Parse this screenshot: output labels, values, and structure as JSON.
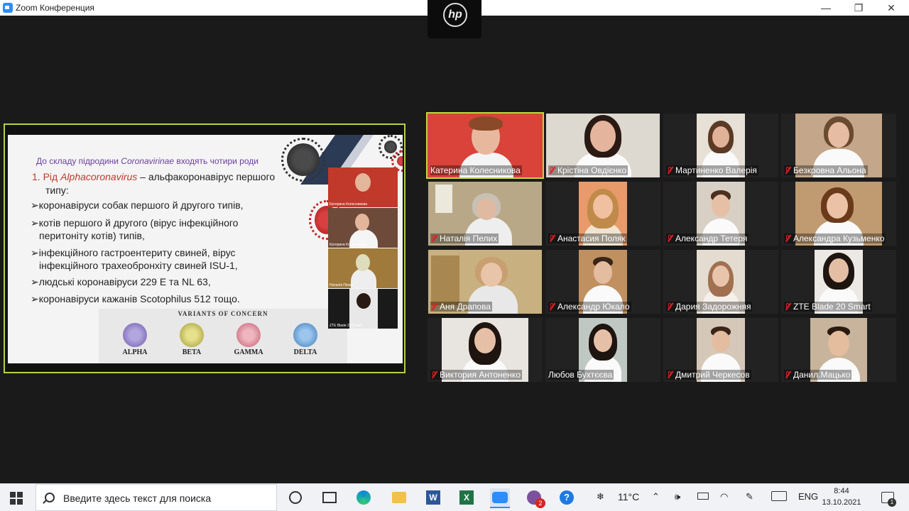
{
  "window": {
    "title": "Zoom Конференция",
    "minimize": "—",
    "restore": "❐",
    "close": "✕",
    "camera_logo": "hp"
  },
  "slide": {
    "heading_pre": "До складу підродини ",
    "heading_italic": "Coronavirinae",
    "heading_post": " входять чотири роди",
    "item1_num": "1.",
    "item1_pre": " Рід ",
    "item1_italic": "Alphacoronavirus",
    "item1_tail": " – альфакоронавірус першого",
    "item1_cont": "типу:",
    "bullets": [
      "коронавіруси собак першого й другого типів,",
      "котів   першого   й   другого   (вірус   інфекційного",
      "перитоніту котів) типів,",
      "інфекційного     гастроентериту     свиней,     вірус",
      "інфекційного трахеобронхіту свиней ISU-1,",
      "людські коронавіруси 229 E та NL 63,",
      "коронавіруси кажанів Scotophilus 512 тощо."
    ],
    "variants_title": "VARIANTS OF CONCERN",
    "variants": [
      "ALPHA",
      "BETA",
      "GAMMA",
      "DELTA"
    ],
    "variant_colors": [
      "#8e7bc0",
      "#c8c25a",
      "#d98a9a",
      "#5b9bd5"
    ],
    "thumbs": [
      "Катерина Колесникова",
      "Катерина Колесникова",
      "Наталія Пелих",
      "ZTE Blade 20 Smart"
    ]
  },
  "participants": [
    {
      "name": "Катерина Колесникова",
      "muted": false
    },
    {
      "name": "Крістіна Овдієнко",
      "muted": true
    },
    {
      "name": "Мартиненко Валерія",
      "muted": true
    },
    {
      "name": "Безкровна Альона",
      "muted": true
    },
    {
      "name": "Наталія Пелих",
      "muted": true
    },
    {
      "name": "Анастасия Поляк",
      "muted": true
    },
    {
      "name": "Александр Тетеря",
      "muted": true
    },
    {
      "name": "Александра Кузьменко",
      "muted": true
    },
    {
      "name": "Аня Драпова",
      "muted": true
    },
    {
      "name": "Александр Юкало",
      "muted": true
    },
    {
      "name": "Дария Задорожняя",
      "muted": true
    },
    {
      "name": "ZTE Blade 20 Smart",
      "muted": true
    },
    {
      "name": "Виктория Антоненко",
      "muted": true
    },
    {
      "name": "Любов Бухтєєва",
      "muted": false
    },
    {
      "name": "Дмитрий Черкесов",
      "muted": true
    },
    {
      "name": "Данил.Мацько",
      "muted": true
    }
  ],
  "taskbar": {
    "search_placeholder": "Введите здесь текст для поиска",
    "badge_count": "2",
    "help_icon": "?",
    "weather": "11°C",
    "language": "ENG",
    "time": "8:44",
    "date": "13.10.2021",
    "notification_count": "1"
  }
}
